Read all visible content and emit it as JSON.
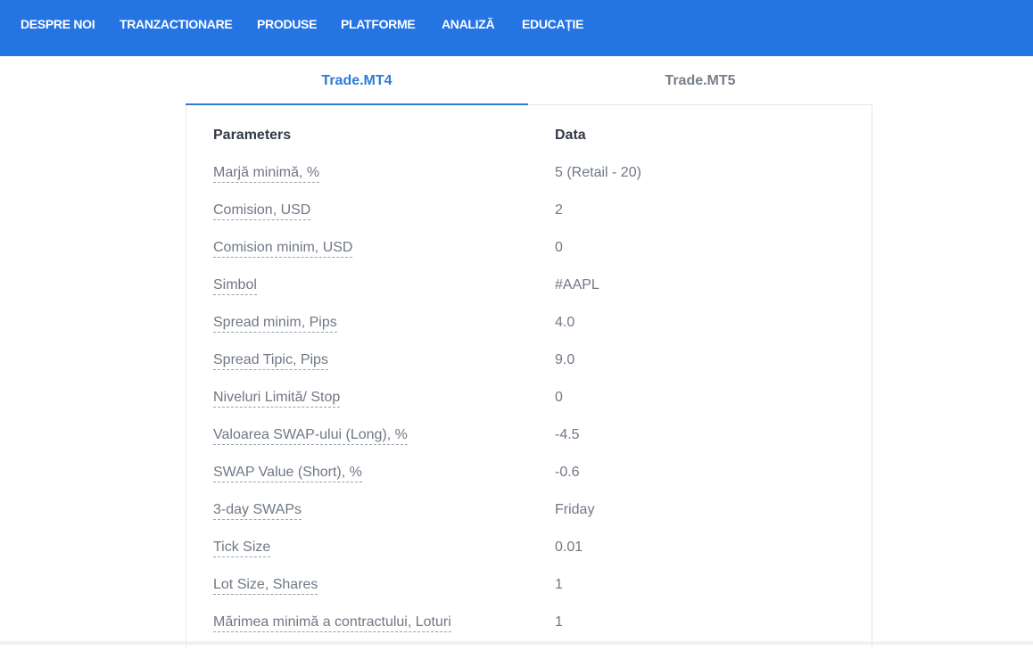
{
  "nav": {
    "items": [
      {
        "label": "DESPRE NOI",
        "id": "despre-noi"
      },
      {
        "label": "TRANZACTIONARE",
        "id": "tranzactionare"
      },
      {
        "label": "PRODUSE",
        "id": "produse"
      },
      {
        "label": "PLATFORME",
        "id": "platforme"
      },
      {
        "label": "ANALIZĂ",
        "id": "analiza"
      },
      {
        "label": "EDUCAȚIE",
        "id": "educatie"
      }
    ]
  },
  "tabs": [
    {
      "label": "Trade.MT4",
      "active": true
    },
    {
      "label": "Trade.MT5",
      "active": false
    }
  ],
  "table": {
    "headers": {
      "param": "Parameters",
      "value": "Data"
    },
    "rows": [
      {
        "param": "Marjă minimă, %",
        "value": "5 (Retail - 20)"
      },
      {
        "param": "Comision, USD",
        "value": "2"
      },
      {
        "param": "Comision minim, USD",
        "value": "0"
      },
      {
        "param": "Simbol",
        "value": "#AAPL"
      },
      {
        "param": "Spread minim, Pips",
        "value": "4.0"
      },
      {
        "param": "Spread Tipic, Pips",
        "value": "9.0"
      },
      {
        "param": "Niveluri Limită/ Stop",
        "value": "0"
      },
      {
        "param": "Valoarea SWAP-ului (Long), %",
        "value": "-4.5"
      },
      {
        "param": "SWAP Value (Short), %",
        "value": "-0.6"
      },
      {
        "param": "3-day SWAPs",
        "value": "Friday"
      },
      {
        "param": "Tick Size",
        "value": "0.01"
      },
      {
        "param": "Lot Size, Shares",
        "value": "1"
      },
      {
        "param": "Mărimea minimă a contractului, Loturi",
        "value": "1"
      }
    ]
  },
  "colors": {
    "nav_bg": "#2474e3",
    "tab_active": "#2f79d9",
    "text_muted": "#707884",
    "text_header": "#333a47"
  }
}
